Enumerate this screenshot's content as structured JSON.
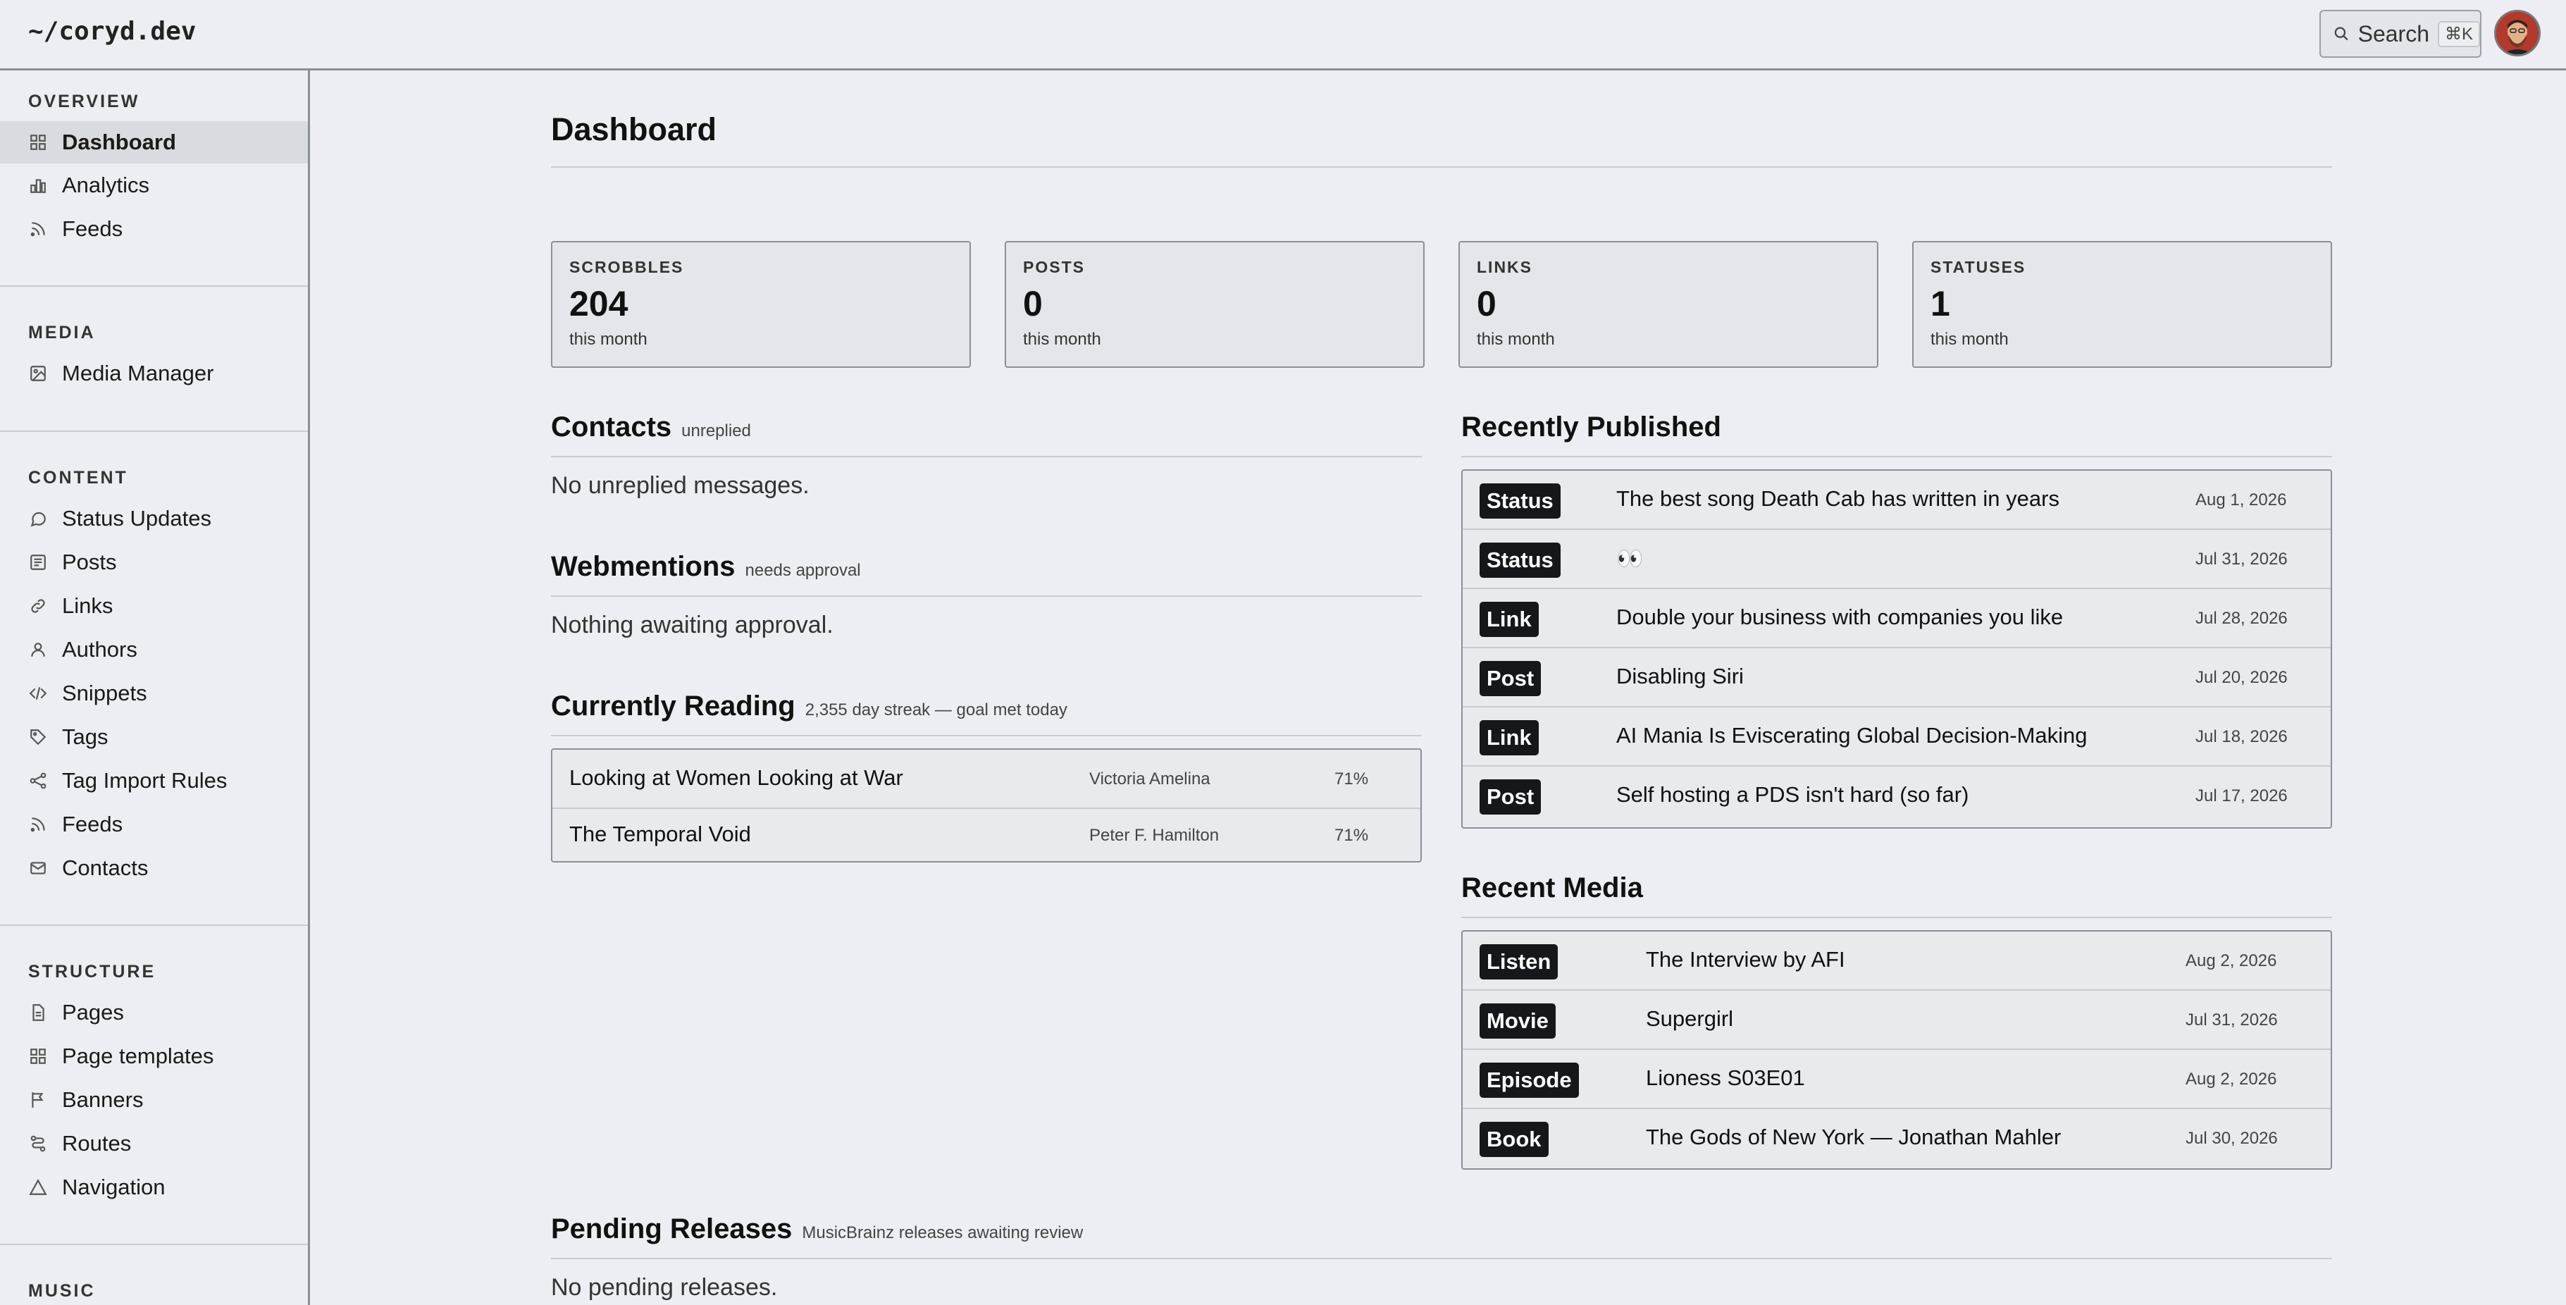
{
  "header": {
    "logo": "~/coryd.dev",
    "search_label": "Search",
    "search_shortcut": "⌘K"
  },
  "sidebar": {
    "sections": [
      {
        "title": "OVERVIEW",
        "items": [
          {
            "label": "Dashboard",
            "icon": "grid-icon",
            "active": true
          },
          {
            "label": "Analytics",
            "icon": "bar-chart-icon"
          },
          {
            "label": "Feeds",
            "icon": "rss-icon"
          }
        ]
      },
      {
        "title": "MEDIA",
        "items": [
          {
            "label": "Media Manager",
            "icon": "image-icon"
          }
        ]
      },
      {
        "title": "CONTENT",
        "items": [
          {
            "label": "Status Updates",
            "icon": "chat-bubble-icon"
          },
          {
            "label": "Posts",
            "icon": "document-lines-icon"
          },
          {
            "label": "Links",
            "icon": "link-icon"
          },
          {
            "label": "Authors",
            "icon": "user-icon"
          },
          {
            "label": "Snippets",
            "icon": "code-icon"
          },
          {
            "label": "Tags",
            "icon": "tag-icon"
          },
          {
            "label": "Tag Import Rules",
            "icon": "share-icon"
          },
          {
            "label": "Feeds",
            "icon": "rss-icon"
          },
          {
            "label": "Contacts",
            "icon": "mail-icon"
          }
        ]
      },
      {
        "title": "STRUCTURE",
        "items": [
          {
            "label": "Pages",
            "icon": "file-icon"
          },
          {
            "label": "Page templates",
            "icon": "grid-icon"
          },
          {
            "label": "Banners",
            "icon": "flag-icon"
          },
          {
            "label": "Routes",
            "icon": "route-icon"
          },
          {
            "label": "Navigation",
            "icon": "triangle-icon"
          }
        ]
      },
      {
        "title": "MUSIC",
        "items": []
      }
    ]
  },
  "main": {
    "title": "Dashboard",
    "stats": [
      {
        "label": "SCROBBLES",
        "value": "204",
        "sub": "this month"
      },
      {
        "label": "POSTS",
        "value": "0",
        "sub": "this month"
      },
      {
        "label": "LINKS",
        "value": "0",
        "sub": "this month"
      },
      {
        "label": "STATUSES",
        "value": "1",
        "sub": "this month"
      }
    ],
    "contacts": {
      "title": "Contacts",
      "subtitle": "unreplied",
      "empty": "No unreplied messages."
    },
    "webmentions": {
      "title": "Webmentions",
      "subtitle": "needs approval",
      "empty": "Nothing awaiting approval."
    },
    "reading": {
      "title": "Currently Reading",
      "subtitle": "2,355 day streak — goal met today",
      "books": [
        {
          "title": "Looking at Women Looking at War",
          "author": "Victoria Amelina",
          "progress": "71%"
        },
        {
          "title": "The Temporal Void",
          "author": "Peter F. Hamilton",
          "progress": "71%"
        }
      ]
    },
    "published": {
      "title": "Recently Published",
      "items": [
        {
          "type": "Status",
          "title": "The best song Death Cab has written in years",
          "date": "Aug 1, 2026"
        },
        {
          "type": "Status",
          "title": "👀",
          "date": "Jul 31, 2026"
        },
        {
          "type": "Link",
          "title": "Double your business with companies you like",
          "date": "Jul 28, 2026"
        },
        {
          "type": "Post",
          "title": "Disabling Siri",
          "date": "Jul 20, 2026"
        },
        {
          "type": "Link",
          "title": "AI Mania Is Eviscerating Global Decision-Making",
          "date": "Jul 18, 2026"
        },
        {
          "type": "Post",
          "title": "Self hosting a PDS isn't hard (so far)",
          "date": "Jul 17, 2026"
        }
      ]
    },
    "media": {
      "title": "Recent Media",
      "items": [
        {
          "type": "Listen",
          "title": "The Interview by AFI",
          "date": "Aug 2, 2026"
        },
        {
          "type": "Movie",
          "title": "Supergirl",
          "date": "Jul 31, 2026"
        },
        {
          "type": "Episode",
          "title": "Lioness S03E01",
          "date": "Aug 2, 2026"
        },
        {
          "type": "Book",
          "title": "The Gods of New York — Jonathan Mahler",
          "date": "Jul 30, 2026"
        }
      ]
    },
    "pending": {
      "title": "Pending Releases",
      "subtitle": "MusicBrainz releases awaiting review",
      "empty": "No pending releases."
    }
  }
}
